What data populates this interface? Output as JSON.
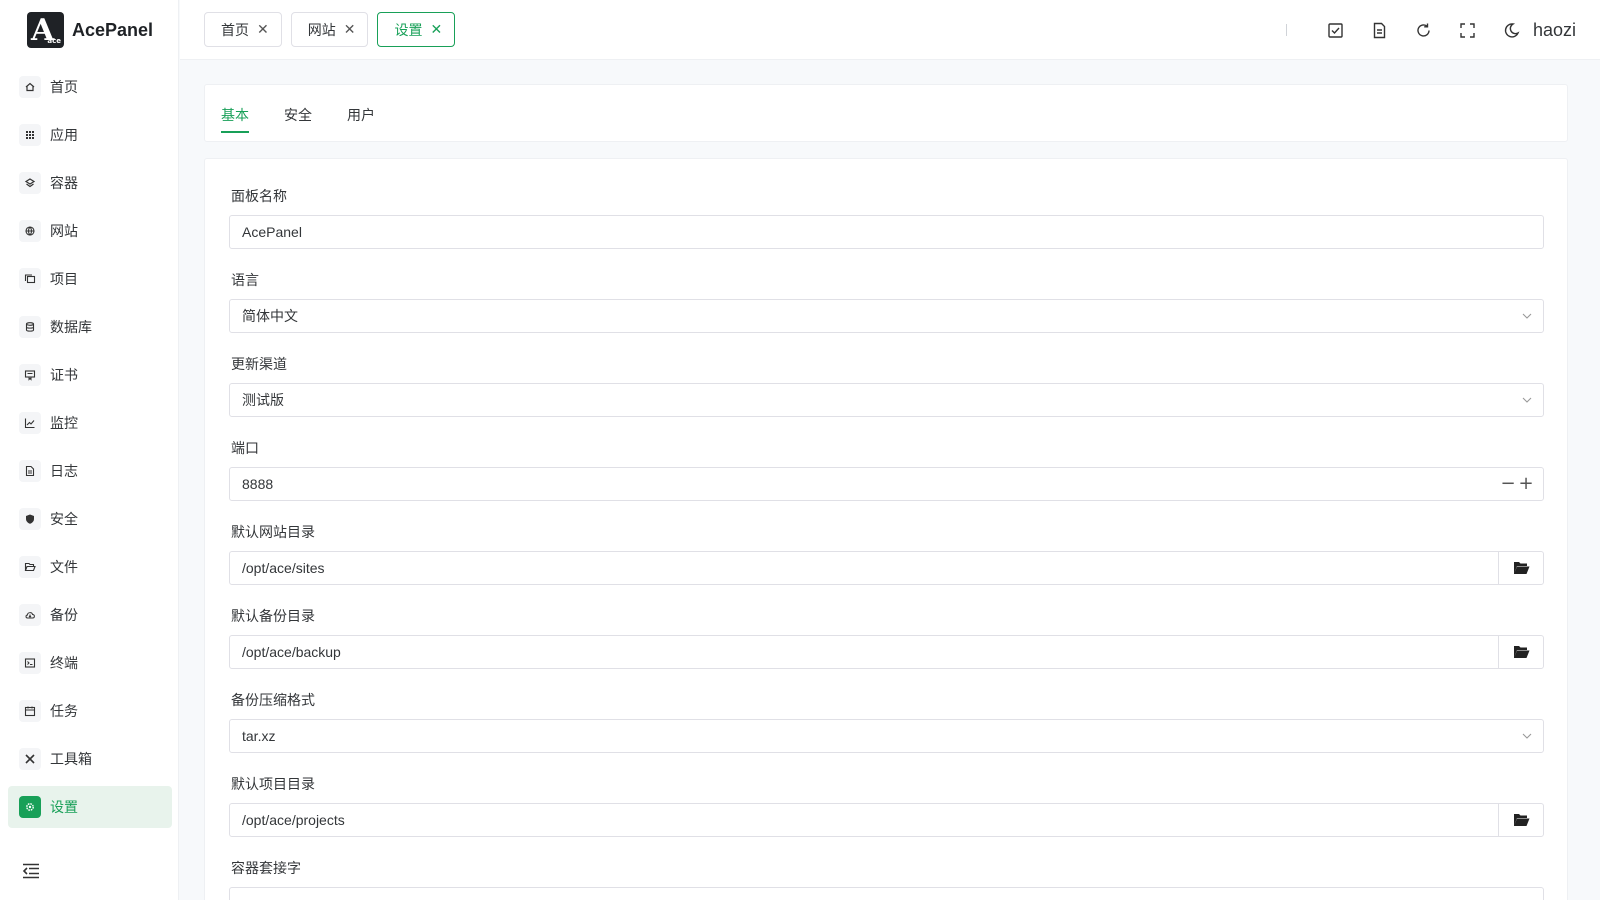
{
  "app": {
    "name": "AcePanel",
    "logo_letter": "A",
    "logo_small": "ace"
  },
  "sidebar": {
    "items": [
      {
        "label": "首页",
        "icon": "home-icon",
        "active": false
      },
      {
        "label": "应用",
        "icon": "apps-grid-icon",
        "active": false
      },
      {
        "label": "容器",
        "icon": "layers-icon",
        "active": false
      },
      {
        "label": "网站",
        "icon": "globe-icon",
        "active": false
      },
      {
        "label": "项目",
        "icon": "folders-icon",
        "active": false
      },
      {
        "label": "数据库",
        "icon": "database-icon",
        "active": false
      },
      {
        "label": "证书",
        "icon": "certificate-icon",
        "active": false
      },
      {
        "label": "监控",
        "icon": "chart-line-icon",
        "active": false
      },
      {
        "label": "日志",
        "icon": "document-icon",
        "active": false
      },
      {
        "label": "安全",
        "icon": "shield-icon",
        "active": false
      },
      {
        "label": "文件",
        "icon": "folder-open-icon",
        "active": false
      },
      {
        "label": "备份",
        "icon": "cloud-icon",
        "active": false
      },
      {
        "label": "终端",
        "icon": "terminal-icon",
        "active": false
      },
      {
        "label": "任务",
        "icon": "calendar-icon",
        "active": false
      },
      {
        "label": "工具箱",
        "icon": "tools-icon",
        "active": false
      },
      {
        "label": "设置",
        "icon": "gear-icon",
        "active": true
      }
    ]
  },
  "header": {
    "tabs": [
      {
        "label": "首页",
        "active": false
      },
      {
        "label": "网站",
        "active": false
      },
      {
        "label": "设置",
        "active": true
      }
    ],
    "close_glyph": "✕",
    "username": "haozi"
  },
  "settings": {
    "subtabs": [
      {
        "label": "基本",
        "active": true
      },
      {
        "label": "安全",
        "active": false
      },
      {
        "label": "用户",
        "active": false
      }
    ],
    "fields": {
      "panel_name": {
        "label": "面板名称",
        "value": "AcePanel"
      },
      "language": {
        "label": "语言",
        "value": "简体中文"
      },
      "update_channel": {
        "label": "更新渠道",
        "value": "测试版"
      },
      "port": {
        "label": "端口",
        "value": "8888",
        "minus": "−",
        "plus": "+"
      },
      "website_dir": {
        "label": "默认网站目录",
        "value": "/opt/ace/sites"
      },
      "backup_dir": {
        "label": "默认备份目录",
        "value": "/opt/ace/backup"
      },
      "backup_format": {
        "label": "备份压缩格式",
        "value": "tar.xz"
      },
      "project_dir": {
        "label": "默认项目目录",
        "value": "/opt/ace/projects"
      },
      "container_socket": {
        "label": "容器套接字",
        "value": ""
      }
    }
  },
  "colors": {
    "accent": "#18a058",
    "accent_bg": "#e8f3ec"
  }
}
